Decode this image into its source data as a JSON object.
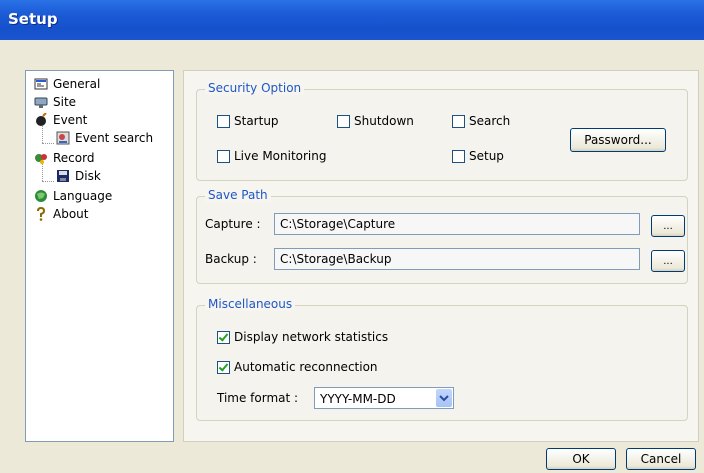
{
  "window": {
    "title": "Setup"
  },
  "tree": {
    "items": [
      {
        "label": "General",
        "icon": "general-icon"
      },
      {
        "label": "Site",
        "icon": "site-icon"
      },
      {
        "label": "Event",
        "icon": "event-icon"
      },
      {
        "label": "Event search",
        "icon": "event-search-icon"
      },
      {
        "label": "Record",
        "icon": "record-icon"
      },
      {
        "label": "Disk",
        "icon": "disk-icon"
      },
      {
        "label": "Language",
        "icon": "language-icon"
      },
      {
        "label": "About",
        "icon": "about-icon"
      }
    ]
  },
  "security": {
    "title": "Security Option",
    "startup": "Startup",
    "shutdown": "Shutdown",
    "search": "Search",
    "live": "Live Monitoring",
    "setup": "Setup",
    "password_btn": "Password..."
  },
  "save_path": {
    "title": "Save Path",
    "capture_label": "Capture :",
    "capture_value": "C:\\Storage\\Capture",
    "backup_label": "Backup :",
    "backup_value": "C:\\Storage\\Backup",
    "browse": "..."
  },
  "misc": {
    "title": "Miscellaneous",
    "netstats": "Display network statistics",
    "reconnect": "Automatic reconnection",
    "time_format_label": "Time format :",
    "time_format_value": "YYYY-MM-DD"
  },
  "footer": {
    "ok": "OK",
    "cancel": "Cancel"
  },
  "colors": {
    "title_bar": "#1c5bd6",
    "group_label": "#1f57c8",
    "dialog_bg": "#ece9d8"
  }
}
